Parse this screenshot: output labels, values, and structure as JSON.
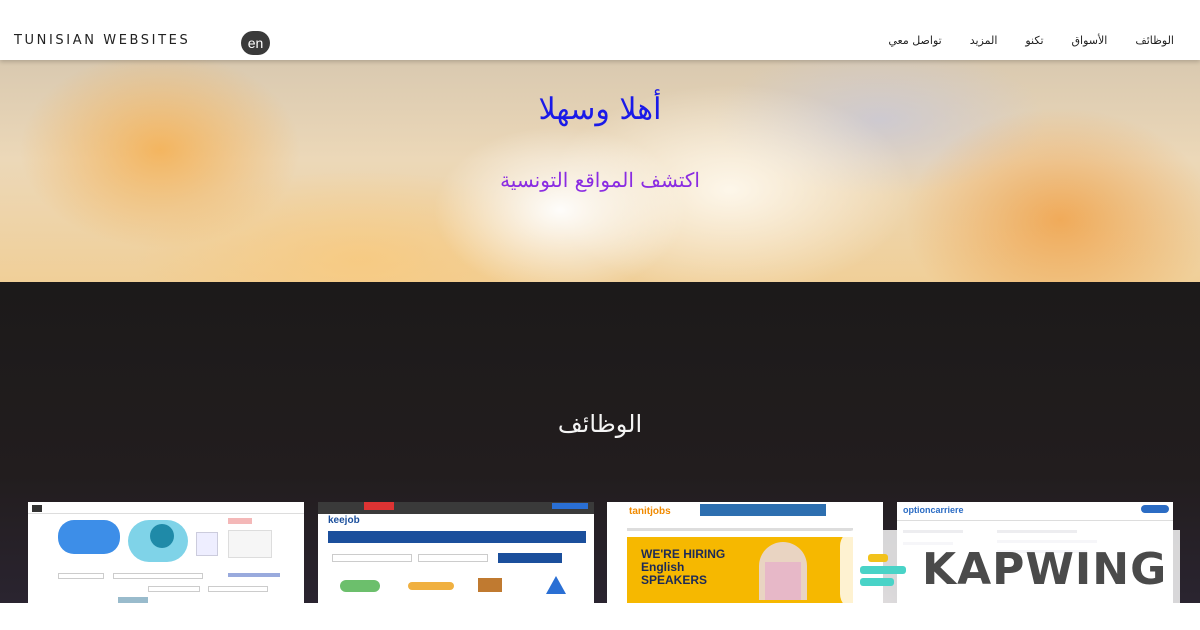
{
  "header": {
    "brand": "TUNISIAN WEBSITES",
    "language_button": "en",
    "nav": [
      "تواصل معي",
      "المزيد",
      "تكنو",
      "الأسواق",
      "الوظائف"
    ]
  },
  "hero": {
    "title": "أهلا وسهلا",
    "subtitle": "اكتشف المواقع التونسية",
    "title_color": "#1a1ae8",
    "subtitle_color": "#8a2be2"
  },
  "jobs_section": {
    "title": "الوظائف",
    "cards": [
      {
        "site_logo": "",
        "headline": ""
      },
      {
        "site_logo": "keejob",
        "headline": ""
      },
      {
        "site_logo": "tanitjobs",
        "headline": "WE'RE HIRING English SPEAKERS"
      },
      {
        "site_logo": "optioncarriere",
        "headline": ""
      }
    ]
  },
  "watermark": {
    "text": "KAPWING"
  }
}
